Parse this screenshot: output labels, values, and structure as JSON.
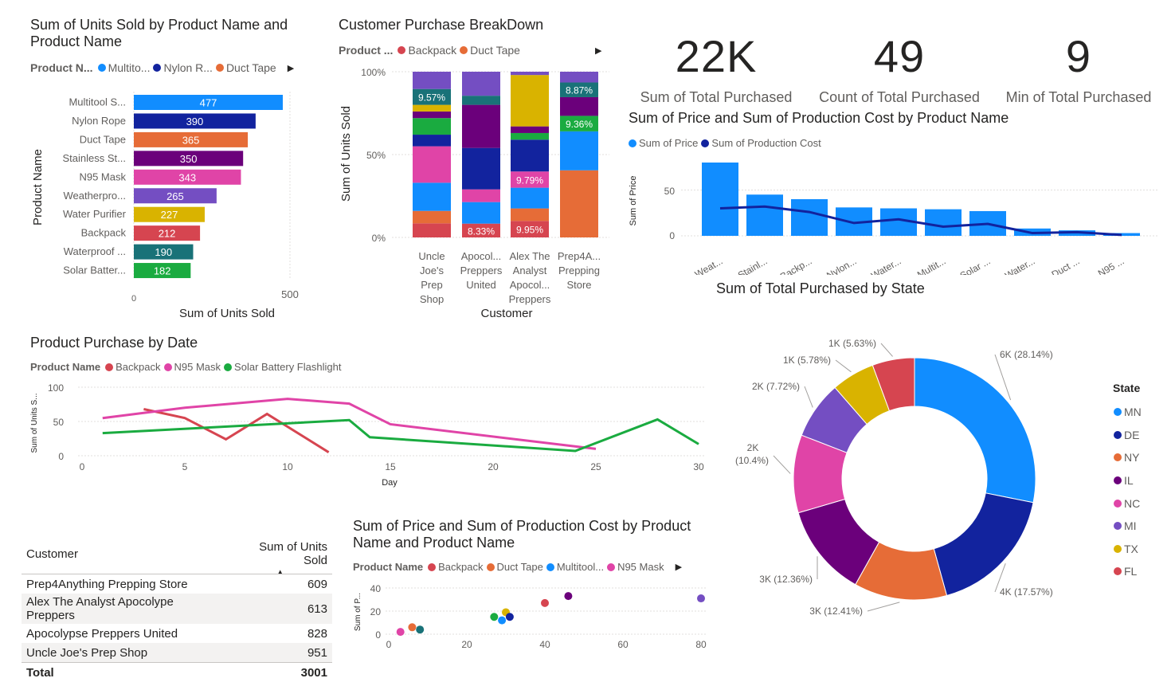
{
  "colors": {
    "c1": "#118DFF",
    "c2": "#12239E",
    "c3": "#E66C37",
    "c4": "#6B007B",
    "c5": "#E044A7",
    "c6": "#744EC2",
    "c7": "#D9B300",
    "c8": "#D64550",
    "c9": "#197278",
    "c10": "#1AAB40"
  },
  "units_chart": {
    "title_line1": "Sum of Units Sold by Product Name and",
    "title_line2": "Product Name",
    "legend_label": "Product N...",
    "legend_items": [
      {
        "label": "Multito...",
        "color": "#118DFF"
      },
      {
        "label": "Nylon R...",
        "color": "#12239E"
      },
      {
        "label": "Duct Tape",
        "color": "#E66C37"
      }
    ],
    "chevron": "▶",
    "ylabel": "Product Name",
    "xlabel": "Sum of Units Sold",
    "xticks": [
      "0",
      "500"
    ]
  },
  "breakdown_chart": {
    "title": "Customer Purchase BreakDown",
    "legend_label": "Product ...",
    "legend_items": [
      {
        "label": "Backpack",
        "color": "#D64550"
      },
      {
        "label": "Duct Tape",
        "color": "#E66C37"
      }
    ],
    "chevron": "▶",
    "ylabel": "Sum of Units Sold",
    "xlabel": "Customer",
    "yticks": [
      "100%",
      "50%",
      "0%"
    ]
  },
  "kpis": [
    {
      "value": "22K",
      "label": "Sum of Total Purchased"
    },
    {
      "value": "49",
      "label": "Count of Total Purchased"
    },
    {
      "value": "9",
      "label": "Min of Total Purchased"
    }
  ],
  "price_chart": {
    "title": "Sum of Price and Sum of Production Cost by Product Name",
    "legend_items": [
      {
        "label": "Sum of Price",
        "color": "#118DFF"
      },
      {
        "label": "Sum of Production Cost",
        "color": "#12239E"
      }
    ],
    "ylabel": "Sum of Price",
    "yticks": [
      "50",
      "0"
    ]
  },
  "state_chart": {
    "title": "Sum of Total Purchased by State",
    "legend_title": "State"
  },
  "date_chart": {
    "title": "Product Purchase by Date",
    "legend_label": "Product Name",
    "legend_items": [
      {
        "label": "Backpack",
        "color": "#D64550"
      },
      {
        "label": "N95 Mask",
        "color": "#E044A7"
      },
      {
        "label": "Solar Battery Flashlight",
        "color": "#1AAB40"
      }
    ],
    "ylabel": "Sum of Units S...",
    "xlabel": "Day",
    "yticks": [
      "100",
      "50",
      "0"
    ],
    "xticks": [
      "0",
      "5",
      "10",
      "15",
      "20",
      "25",
      "30"
    ]
  },
  "customer_table": {
    "col1": "Customer",
    "col2": "Sum of Units Sold",
    "sort_icon": "▲",
    "rows": [
      {
        "customer": "Prep4Anything Prepping Store",
        "units": "609"
      },
      {
        "customer": "Alex The Analyst Apocolype Preppers",
        "units": "613"
      },
      {
        "customer": "Apocolypse Preppers United",
        "units": "828"
      },
      {
        "customer": "Uncle Joe's Prep Shop",
        "units": "951"
      }
    ],
    "total_label": "Total",
    "total_value": "3001"
  },
  "scatter_chart": {
    "title_line1": "Sum of Price and Sum of Production Cost by Product",
    "title_line2": "Name and Product Name",
    "legend_label": "Product Name",
    "legend_items": [
      {
        "label": "Backpack",
        "color": "#D64550"
      },
      {
        "label": "Duct Tape",
        "color": "#E66C37"
      },
      {
        "label": "Multitool...",
        "color": "#118DFF"
      },
      {
        "label": "N95 Mask",
        "color": "#E044A7"
      }
    ],
    "chevron": "▶",
    "ylabel": "Sum of P...",
    "yticks": [
      "40",
      "20",
      "0"
    ],
    "xticks": [
      "0",
      "20",
      "40",
      "60",
      "80"
    ]
  },
  "chart_data": [
    {
      "type": "bar",
      "orientation": "horizontal",
      "title": "Sum of Units Sold by Product Name and Product Name",
      "xlabel": "Sum of Units Sold",
      "ylabel": "Product Name",
      "xlim": [
        0,
        500
      ],
      "categories": [
        "Multitool S...",
        "Nylon Rope",
        "Duct Tape",
        "Stainless St...",
        "N95 Mask",
        "Weatherpro...",
        "Water Purifier",
        "Backpack",
        "Waterproof ...",
        "Solar Batter..."
      ],
      "values": [
        477,
        390,
        365,
        350,
        343,
        265,
        227,
        212,
        190,
        182
      ],
      "colors": [
        "#118DFF",
        "#12239E",
        "#E66C37",
        "#6B007B",
        "#E044A7",
        "#744EC2",
        "#D9B300",
        "#D64550",
        "#197278",
        "#1AAB40"
      ]
    },
    {
      "type": "bar",
      "stacked": "100%",
      "title": "Customer Purchase BreakDown",
      "xlabel": "Customer",
      "ylabel": "Sum of Units Sold",
      "categories": [
        {
          "lines": [
            "Uncle",
            "Joe's",
            "Prep",
            "Shop"
          ]
        },
        {
          "lines": [
            "Apocol...",
            "Preppers",
            "United"
          ]
        },
        {
          "lines": [
            "Alex The",
            "Analyst",
            "Apocol...",
            "Preppers"
          ]
        },
        {
          "lines": [
            "Prep4A...",
            "Prepping",
            "Store"
          ]
        }
      ],
      "stacks": [
        {
          "segments": [
            {
              "color": "#D64550",
              "value": 8.5
            },
            {
              "color": "#E66C37",
              "value": 7.5
            },
            {
              "color": "#118DFF",
              "value": 17.0
            },
            {
              "color": "#E044A7",
              "value": 22.0
            },
            {
              "color": "#12239E",
              "value": 7.0
            },
            {
              "color": "#1AAB40",
              "value": 10.0
            },
            {
              "color": "#6B007B",
              "value": 4.0
            },
            {
              "color": "#D9B300",
              "value": 4.0
            },
            {
              "color": "#197278",
              "value": 9.57,
              "label": "9.57%"
            },
            {
              "color": "#744EC2",
              "value": 10.43
            }
          ]
        },
        {
          "segments": [
            {
              "color": "#D64550",
              "value": 8.33,
              "label": "8.33%"
            },
            {
              "color": "#118DFF",
              "value": 13.0
            },
            {
              "color": "#E044A7",
              "value": 7.67
            },
            {
              "color": "#12239E",
              "value": 25.0
            },
            {
              "color": "#6B007B",
              "value": 26.0
            },
            {
              "color": "#197278",
              "value": 5.5
            },
            {
              "color": "#744EC2",
              "value": 14.5
            }
          ]
        },
        {
          "segments": [
            {
              "color": "#D64550",
              "value": 9.95,
              "label": "9.95%"
            },
            {
              "color": "#E66C37",
              "value": 7.55
            },
            {
              "color": "#118DFF",
              "value": 12.5
            },
            {
              "color": "#E044A7",
              "value": 9.79,
              "label": "9.79%"
            },
            {
              "color": "#12239E",
              "value": 19.21
            },
            {
              "color": "#1AAB40",
              "value": 4.0
            },
            {
              "color": "#6B007B",
              "value": 4.0
            },
            {
              "color": "#D9B300",
              "value": 31.0
            },
            {
              "color": "#744EC2",
              "value": 2.0
            }
          ]
        },
        {
          "segments": [
            {
              "color": "#E66C37",
              "value": 40.5
            },
            {
              "color": "#118DFF",
              "value": 23.5
            },
            {
              "color": "#1AAB40",
              "value": 9.36,
              "label": "9.36%"
            },
            {
              "color": "#6B007B",
              "value": 11.27
            },
            {
              "color": "#197278",
              "value": 8.87,
              "label": "8.87%"
            },
            {
              "color": "#744EC2",
              "value": 6.5
            }
          ]
        }
      ]
    },
    {
      "type": "bar",
      "combo": "bar+line",
      "title": "Sum of Price and Sum of Production Cost by Product Name",
      "ylabel": "Sum of Price",
      "ylim": [
        0,
        80
      ],
      "categories": [
        "Weat...",
        "Stainl...",
        "Backp...",
        "Nylon...",
        "Water...",
        "Multit...",
        "Solar ...",
        "Water...",
        "Duct ...",
        "N95 ..."
      ],
      "series": [
        {
          "name": "Sum of Price",
          "type": "bar",
          "color": "#118DFF",
          "values": [
            80,
            45,
            40,
            31,
            30,
            29,
            27,
            8,
            6,
            3
          ]
        },
        {
          "name": "Sum of Production Cost",
          "type": "line",
          "color": "#12239E",
          "values": [
            30,
            32,
            26,
            14,
            18,
            10,
            13,
            3,
            4,
            1
          ]
        }
      ]
    },
    {
      "type": "pie",
      "donut": true,
      "title": "Sum of Total Purchased by State",
      "legend_title": "State",
      "slices": [
        {
          "label": "MN",
          "value": 28.14,
          "display": "6K (28.14%)",
          "color": "#118DFF"
        },
        {
          "label": "DE",
          "value": 17.57,
          "display": "4K (17.57%)",
          "color": "#12239E"
        },
        {
          "label": "NY",
          "value": 12.41,
          "display": "3K (12.41%)",
          "color": "#E66C37"
        },
        {
          "label": "IL",
          "value": 12.36,
          "display": "3K (12.36%)",
          "color": "#6B007B"
        },
        {
          "label": "NC",
          "value": 10.4,
          "display": "2K (10.4%)",
          "color": "#E044A7"
        },
        {
          "label": "MI",
          "value": 7.72,
          "display": "2K (7.72%)",
          "color": "#744EC2"
        },
        {
          "label": "TX",
          "value": 5.78,
          "display": "1K (5.78%)",
          "color": "#D9B300"
        },
        {
          "label": "FL",
          "value": 5.63,
          "display": "1K (5.63%)",
          "color": "#D64550"
        }
      ]
    },
    {
      "type": "line",
      "title": "Product Purchase by Date",
      "xlabel": "Day",
      "ylabel": "Sum of Units S...",
      "xlim": [
        0,
        30
      ],
      "ylim": [
        0,
        100
      ],
      "series": [
        {
          "name": "Backpack",
          "color": "#D64550",
          "x": [
            3,
            5,
            7,
            9,
            12
          ],
          "y": [
            68,
            55,
            24,
            61,
            5
          ]
        },
        {
          "name": "N95 Mask",
          "color": "#E044A7",
          "x": [
            1,
            5,
            10,
            13,
            15,
            25
          ],
          "y": [
            55,
            70,
            83,
            76,
            46,
            10
          ]
        },
        {
          "name": "Solar Battery Flashlight",
          "color": "#1AAB40",
          "x": [
            1,
            13,
            14,
            24,
            28,
            30
          ],
          "y": [
            33,
            52,
            27,
            7,
            53,
            17
          ]
        }
      ]
    },
    {
      "type": "scatter",
      "title": "Sum of Price and Sum of Production Cost by Product Name and Product Name",
      "ylabel": "Sum of P...",
      "xlim": [
        0,
        80
      ],
      "ylim": [
        0,
        40
      ],
      "points": [
        {
          "x": 3,
          "y": 2,
          "color": "#E044A7"
        },
        {
          "x": 6,
          "y": 6,
          "color": "#E66C37"
        },
        {
          "x": 8,
          "y": 4,
          "color": "#197278"
        },
        {
          "x": 27,
          "y": 15,
          "color": "#1AAB40"
        },
        {
          "x": 29,
          "y": 12,
          "color": "#118DFF"
        },
        {
          "x": 30,
          "y": 19,
          "color": "#D9B300"
        },
        {
          "x": 31,
          "y": 15,
          "color": "#12239E"
        },
        {
          "x": 40,
          "y": 27,
          "color": "#D64550"
        },
        {
          "x": 46,
          "y": 33,
          "color": "#6B007B"
        },
        {
          "x": 80,
          "y": 31,
          "color": "#744EC2"
        }
      ]
    }
  ]
}
